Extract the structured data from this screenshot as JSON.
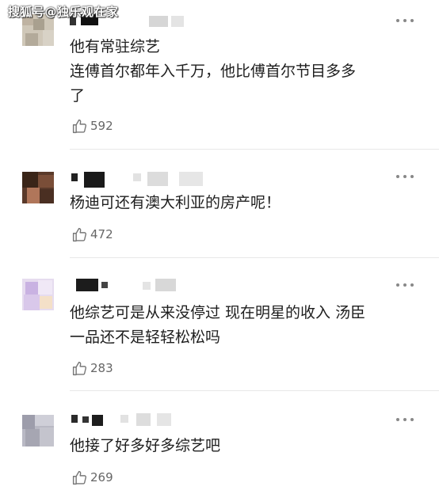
{
  "watermark": "搜狐号@独乐观在家",
  "comments": [
    {
      "text": "他有常驻综艺\n连傅首尔都年入千万，他比傅首尔节目多多\n了",
      "likes": "592"
    },
    {
      "text": "杨迪可还有澳大利亚的房产呢！",
      "likes": "472"
    },
    {
      "text": "他综艺可是从来没停过 现在明星的收入 汤臣\n一品还不是轻轻松松吗",
      "likes": "283"
    },
    {
      "text": "他接了好多好多综艺吧",
      "likes": "269"
    }
  ],
  "icons": {
    "like": "thumbs-up-icon",
    "more": "more-dots-icon"
  }
}
